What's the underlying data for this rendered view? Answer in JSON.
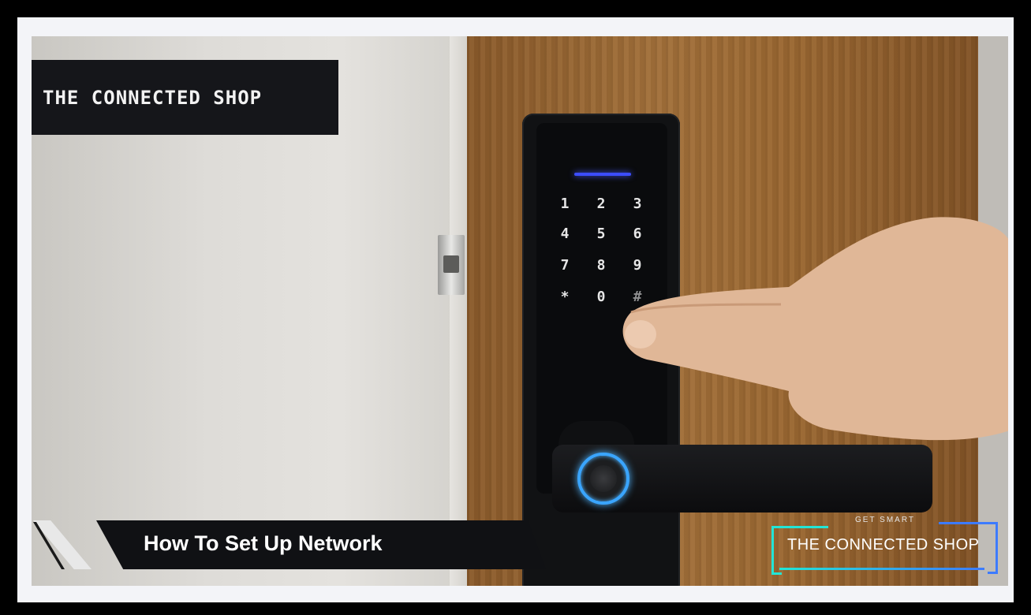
{
  "video": {
    "logo_text": "THE CONNECTED SHOP",
    "title": "How To Set Up Network",
    "badge_small": "GET SMART",
    "badge_text": "THE CONNECTED SHOP"
  },
  "keypad": [
    "1",
    "2",
    "3",
    "4",
    "5",
    "6",
    "7",
    "8",
    "9",
    "*",
    "0",
    "#"
  ],
  "colors": {
    "accent_cyan": "#22e5d6",
    "accent_blue": "#3d7bff",
    "led_blue": "#3c4dff"
  }
}
